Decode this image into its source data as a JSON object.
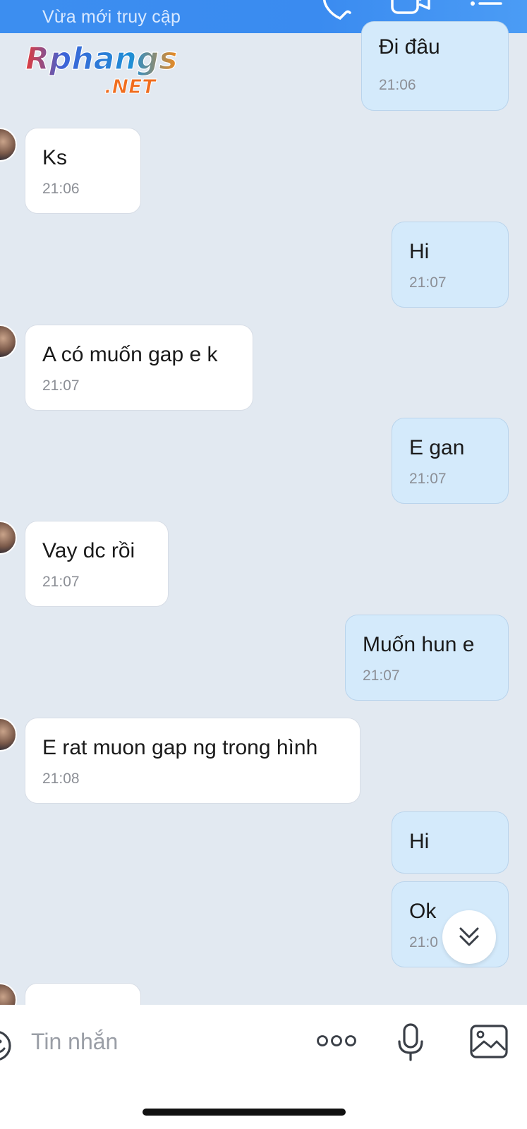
{
  "header": {
    "status": "Vừa mới truy cập",
    "icons": [
      "phone-icon",
      "video-call-icon",
      "list-menu-icon"
    ]
  },
  "logo": {
    "main": "Rphangs",
    "sub": ".NET"
  },
  "messages": [
    {
      "dir": "out",
      "text": "Đi đâu",
      "time": "21:06"
    },
    {
      "dir": "in",
      "text": "Ks",
      "time": "21:06"
    },
    {
      "dir": "out",
      "text": "Hi",
      "time": "21:07"
    },
    {
      "dir": "in",
      "text": "A có muốn gap e k",
      "time": "21:07"
    },
    {
      "dir": "out",
      "text": "E gan",
      "time": "21:07"
    },
    {
      "dir": "in",
      "text": "Vay dc rồi",
      "time": "21:07"
    },
    {
      "dir": "out",
      "text": "Muốn hun e",
      "time": "21:07"
    },
    {
      "dir": "in",
      "text": "E rat muon gap ng trong hình",
      "time": "21:08"
    },
    {
      "dir": "out",
      "text": "Hi",
      "time": ""
    },
    {
      "dir": "out",
      "text": "Ok",
      "time": "21:0"
    }
  ],
  "composer": {
    "placeholder": "Tin nhắn",
    "icons": [
      "sticker-icon",
      "more-options-icon",
      "microphone-icon",
      "image-icon"
    ]
  },
  "scroll_button": {
    "icon": "double-chevron-down-icon"
  }
}
